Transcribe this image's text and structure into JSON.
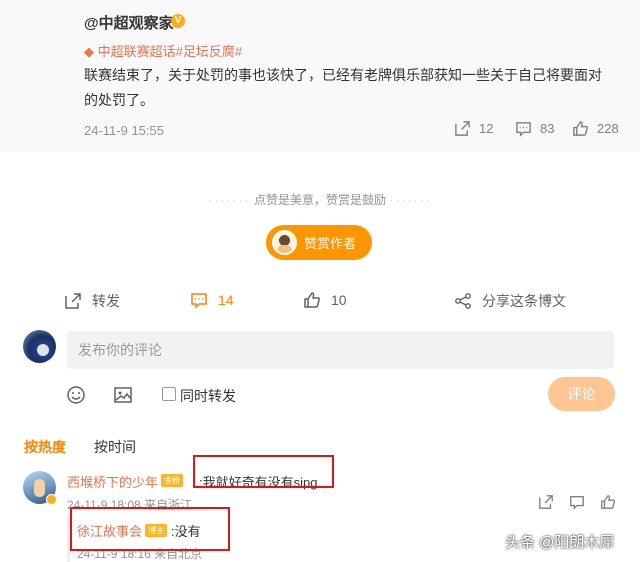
{
  "repost": {
    "author": "@中超观察家",
    "verified_icon": "v-badge-icon",
    "topics": "中超联赛超话#足坛反腐#",
    "content": "联赛结束了，关于处罚的事也该快了，已经有老牌俱乐部获知一些关于自己将要面对的处罚了。",
    "date": "24-11-9 15:55",
    "stats": {
      "reposts": "12",
      "comments": "83",
      "likes": "228"
    }
  },
  "reward": {
    "note_left": "点赞是美意，赞赏是鼓励",
    "dash": "·······",
    "button_label": "赞赏作者"
  },
  "actions": {
    "repost_label": "转发",
    "comment_count": "14",
    "like_count": "10",
    "share_label": "分享这条博文"
  },
  "composer": {
    "placeholder": "发布你的评论",
    "also_repost_label": "同时转发",
    "submit_label": "评论"
  },
  "sort": {
    "hot_label": "按热度",
    "time_label": "按时间"
  },
  "comment": {
    "author": "西堠桥下的少年",
    "badge": "金粉",
    "text": ":我就好奇有没有sipg",
    "meta": "24-11-9 18:08 来自浙江"
  },
  "reply": {
    "author": "徐江故事会",
    "badge": "博主",
    "text": ":没有",
    "meta": "24-11-9 18:16 来自北京"
  },
  "watermark": "头条 @阳朗木犀",
  "colors": {
    "accent": "#ff8200",
    "name": "#eb7350",
    "highlight": "#e01515",
    "submit_disabled": "#ffc593"
  }
}
